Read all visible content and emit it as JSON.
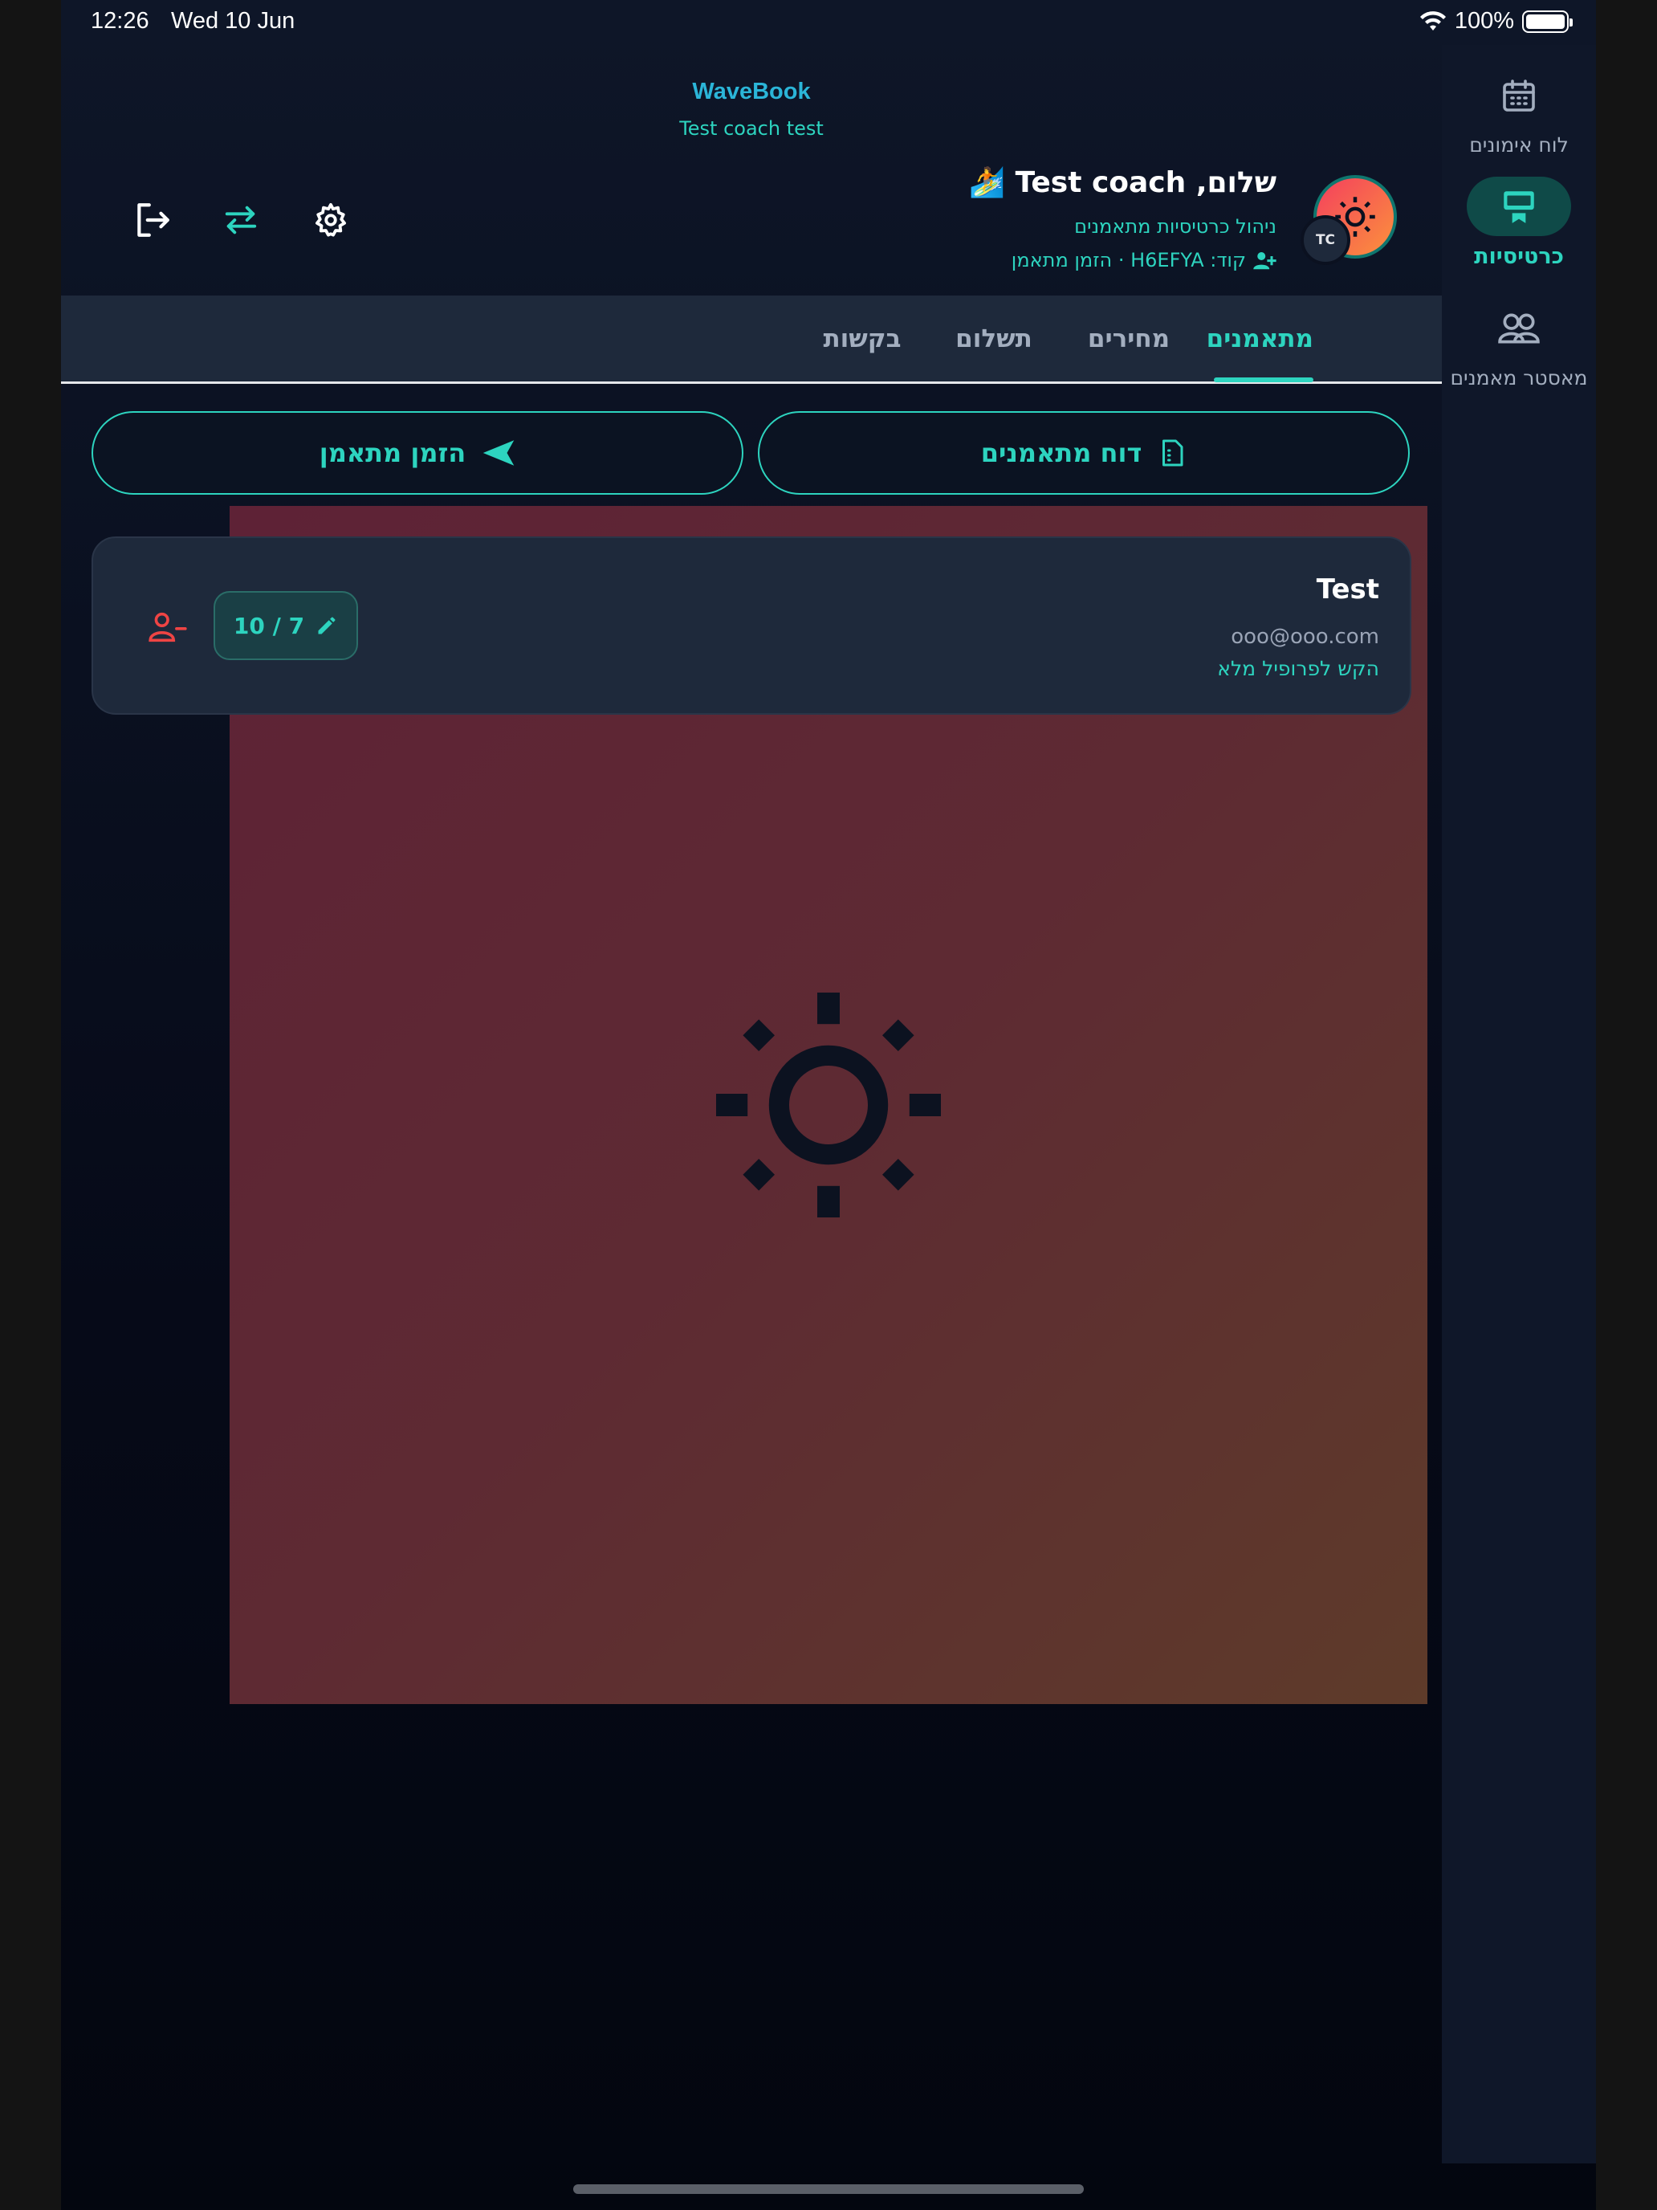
{
  "status_bar": {
    "time": "12:26",
    "date": "Wed 10 Jun",
    "battery": "100%"
  },
  "header": {
    "app_name": "WaveBook",
    "account_label": "Test coach test",
    "greeting": "שלום, Test coach 🏄",
    "subtitle": "ניהול כרטיסיות מתאמנים",
    "invite_line": "קוד: H6EFYA · הזמן מתאמן",
    "avatar_initials": "TC"
  },
  "side_nav": {
    "items": [
      {
        "label": "לוח אימונים",
        "icon": "calendar-icon",
        "active": false
      },
      {
        "label": "כרטיסיות",
        "icon": "card-icon",
        "active": true
      },
      {
        "label": "מאסטר מאמנים",
        "icon": "users-icon",
        "active": false
      }
    ]
  },
  "tabs": [
    {
      "label": "מתאמנים",
      "active": true
    },
    {
      "label": "מחירים",
      "active": false
    },
    {
      "label": "תשלום",
      "active": false
    },
    {
      "label": "בקשות",
      "active": false
    }
  ],
  "actions": {
    "report_label": "דוח מתאמנים",
    "invite_label": "הזמן מתאמן"
  },
  "trainee": {
    "name": "Test",
    "email": "ooo@ooo.com",
    "profile_hint": "הקש לפרופיל מלא",
    "sessions": "10 / 7"
  },
  "colors": {
    "accent": "#2dd4bf",
    "brand": "#2bb5d8",
    "danger": "#ef4444",
    "panel": "#1e293b",
    "background": "#0e1628"
  }
}
